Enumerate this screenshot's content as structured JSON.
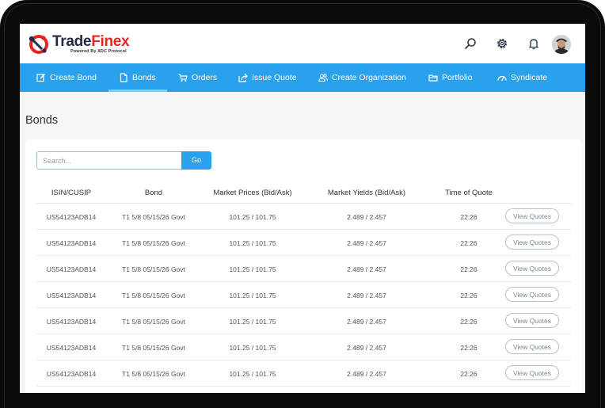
{
  "brand": {
    "name_part1": "Trade",
    "name_part2": "Finex",
    "tagline": "Powered By XDC Protocol"
  },
  "header_icons": [
    "search-icon",
    "gear-icon",
    "bell-icon",
    "user-avatar"
  ],
  "nav": {
    "items": [
      {
        "label": "Create Bond",
        "icon": "edit-icon"
      },
      {
        "label": "Bonds",
        "icon": "document-icon",
        "active": true
      },
      {
        "label": "Orders",
        "icon": "cart-icon"
      },
      {
        "label": "Issue Quote",
        "icon": "share-icon"
      },
      {
        "label": "Create Organization",
        "icon": "users-icon"
      },
      {
        "label": "Portfolio",
        "icon": "folder-icon"
      },
      {
        "label": "Syndicate",
        "icon": "gauge-icon"
      }
    ]
  },
  "page": {
    "title": "Bonds"
  },
  "search": {
    "placeholder": "Search...",
    "value": "",
    "button_label": "Go"
  },
  "table": {
    "columns": [
      "ISIN/CUSIP",
      "Bond",
      "Market Prices (Bid/Ask)",
      "Market Yields (Bid/Ask)",
      "Time of Quote"
    ],
    "action_label": "View Quotes",
    "rows": [
      [
        "US54123ADB14",
        "T1 5/8 05/15/26 Govt",
        "101.25 / 101.75",
        "2.489 / 2.457",
        "22:26"
      ],
      [
        "US54123ADB14",
        "T1 5/8 05/15/26 Govt",
        "101.25 / 101.75",
        "2.489 / 2.457",
        "22:26"
      ],
      [
        "US54123ADB14",
        "T1 5/8 05/15/26 Govt",
        "101.25 / 101.75",
        "2.489 / 2.457",
        "22:26"
      ],
      [
        "US54123ADB14",
        "T1 5/8 05/15/26 Govt",
        "101.25 / 101.75",
        "2.489 / 2.457",
        "22:26"
      ],
      [
        "US54123ADB14",
        "T1 5/8 05/15/26 Govt",
        "101.25 / 101.75",
        "2.489 / 2.457",
        "22:26"
      ],
      [
        "US54123ADB14",
        "T1 5/8 05/15/26 Govt",
        "101.25 / 101.75",
        "2.489 / 2.457",
        "22:26"
      ],
      [
        "US54123ADB14",
        "T1 5/8 05/15/26 Govt",
        "101.25 / 101.75",
        "2.489 / 2.457",
        "22:26"
      ]
    ]
  },
  "colors": {
    "nav_bg": "#2aa1ec",
    "brand_dark": "#222b45",
    "brand_red": "#e52521",
    "device_bezel": "#0b0b0b"
  }
}
